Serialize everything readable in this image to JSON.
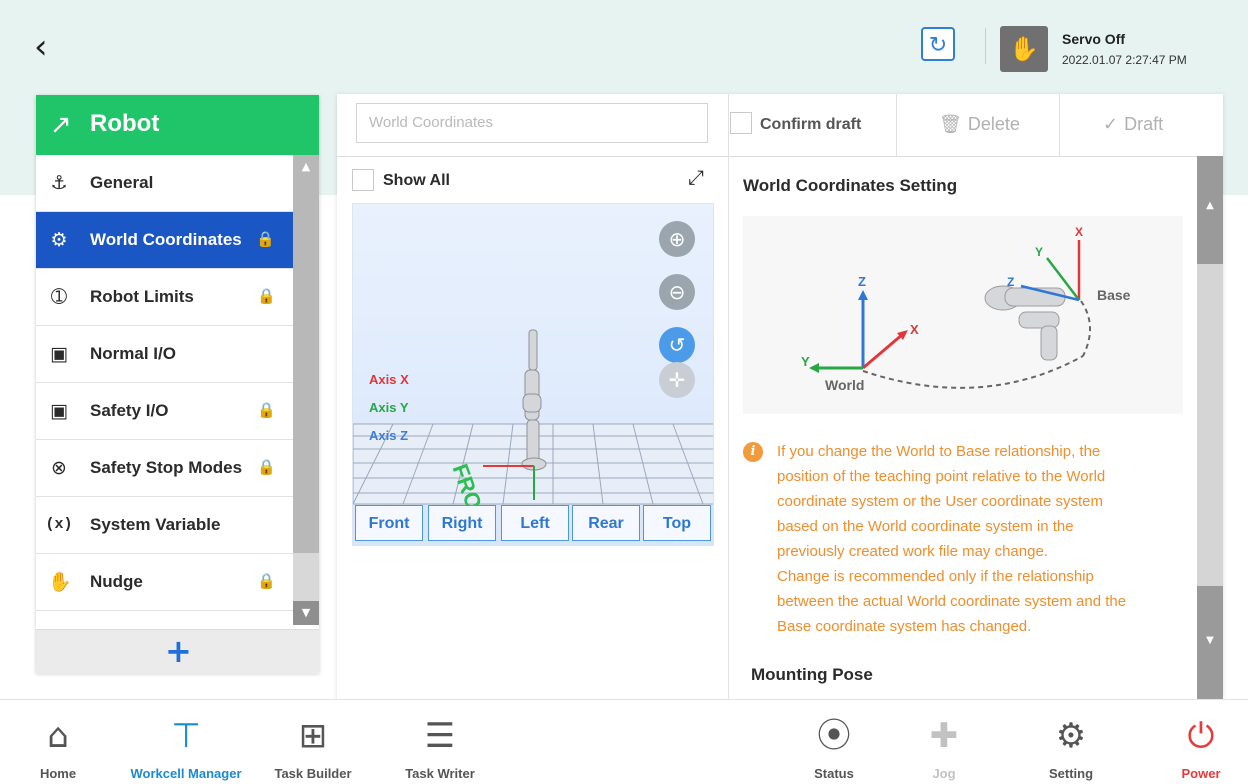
{
  "header": {
    "servo_status": "Servo Off",
    "datetime": "2022.01.07 2:27:47 PM"
  },
  "sidebar": {
    "title": "Robot",
    "items": [
      {
        "label": "General",
        "icon": "robot-arm-icon",
        "locked": false,
        "active": false
      },
      {
        "label": "World Coordinates",
        "icon": "globe-gear-icon",
        "locked": true,
        "active": true
      },
      {
        "label": "Robot Limits",
        "icon": "limit-icon",
        "locked": true,
        "active": false
      },
      {
        "label": "Normal I/O",
        "icon": "io-icon",
        "locked": false,
        "active": false
      },
      {
        "label": "Safety I/O",
        "icon": "io-icon",
        "locked": true,
        "active": false
      },
      {
        "label": "Safety Stop Modes",
        "icon": "stop-icon",
        "locked": true,
        "active": false
      },
      {
        "label": "System Variable",
        "icon": "variable-icon",
        "locked": false,
        "active": false
      },
      {
        "label": "Nudge",
        "icon": "hand-icon",
        "locked": true,
        "active": false
      }
    ],
    "variable_icon_text": "(x)"
  },
  "toolbar": {
    "name_placeholder": "World Coordinates",
    "confirm_label": "Confirm draft",
    "delete_label": "Delete",
    "draft_label": "Draft"
  },
  "viewer": {
    "show_all_label": "Show All",
    "axis_x": "Axis X",
    "axis_y": "Axis Y",
    "axis_z": "Axis Z",
    "floor_label": "FRONT",
    "views": [
      "Front",
      "Right",
      "Left",
      "Rear",
      "Top"
    ]
  },
  "settings": {
    "title": "World Coordinates Setting",
    "diagram": {
      "world_label": "World",
      "base_label": "Base",
      "x": "X",
      "y": "Y",
      "z": "Z"
    },
    "info_lines": [
      "If you change the World to Base relationship, the",
      "position of the teaching point relative to the World",
      "coordinate system or the User coordinate system",
      "based on the World coordinate system in the",
      "previously created work file may change.",
      "Change is recommended only if the relationship",
      "between the actual World coordinate system and the",
      "Base coordinate system has changed."
    ],
    "mounting_title": "Mounting Pose"
  },
  "bottom_nav": [
    {
      "label": "Home",
      "icon": "home-icon"
    },
    {
      "label": "Workcell Manager",
      "icon": "workcell-icon"
    },
    {
      "label": "Task Builder",
      "icon": "task-builder-icon"
    },
    {
      "label": "Task Writer",
      "icon": "task-writer-icon"
    },
    {
      "label": "Status",
      "icon": "status-icon"
    },
    {
      "label": "Jog",
      "icon": "jog-icon"
    },
    {
      "label": "Setting",
      "icon": "gear-icon"
    },
    {
      "label": "Power",
      "icon": "power-icon"
    }
  ],
  "colors": {
    "accent_green": "#20c56a",
    "active_blue": "#1a56c4",
    "warning_orange": "#ef8e2c",
    "power_red": "#e53b3b"
  }
}
